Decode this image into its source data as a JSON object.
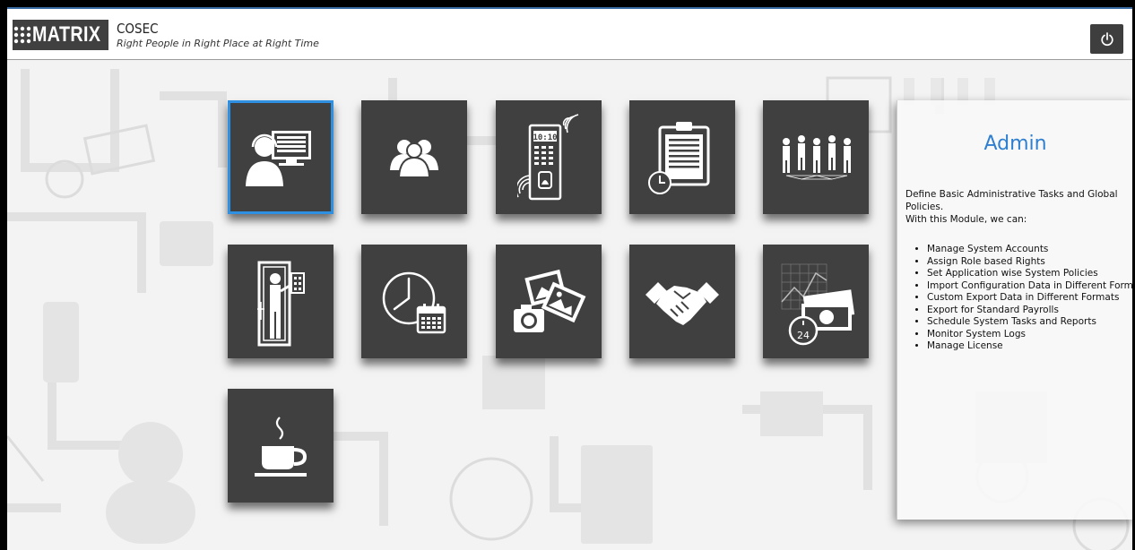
{
  "header": {
    "logo_text": "MATRIX",
    "app_name": "COSEC",
    "tagline": "Right People in Right Place at Right Time",
    "power_icon": "power-icon"
  },
  "tiles": [
    {
      "icon": "admin-operator-icon",
      "selected": true
    },
    {
      "icon": "users-group-icon",
      "selected": false
    },
    {
      "icon": "biometric-device-icon",
      "selected": false,
      "device_time": "10:10"
    },
    {
      "icon": "clipboard-clock-icon",
      "selected": false
    },
    {
      "icon": "organization-people-icon",
      "selected": false
    },
    {
      "icon": "door-access-icon",
      "selected": false
    },
    {
      "icon": "clock-calendar-icon",
      "selected": false
    },
    {
      "icon": "camera-photos-icon",
      "selected": false
    },
    {
      "icon": "handshake-icon",
      "selected": false
    },
    {
      "icon": "payroll-chart-icon",
      "selected": false,
      "badge": "24"
    },
    {
      "icon": "coffee-cup-icon",
      "selected": false
    }
  ],
  "panel": {
    "title": "Admin",
    "description_line1": "Define Basic Administrative Tasks and Global Policies.",
    "description_line2": "With this Module, we can:",
    "items": [
      "Manage System Accounts",
      "Assign Role based Rights",
      "Set Application wise System Policies",
      "Import Configuration Data in Different Formats",
      "Custom Export Data in Different Formats",
      "Export for Standard Payrolls",
      "Schedule System Tasks and Reports",
      "Monitor System Logs",
      "Manage License"
    ]
  },
  "colors": {
    "tile": "#404040",
    "selected_outline": "#2f8fe0",
    "panel_title": "#2f7fd0",
    "header_accent": "#3a6ea5"
  }
}
